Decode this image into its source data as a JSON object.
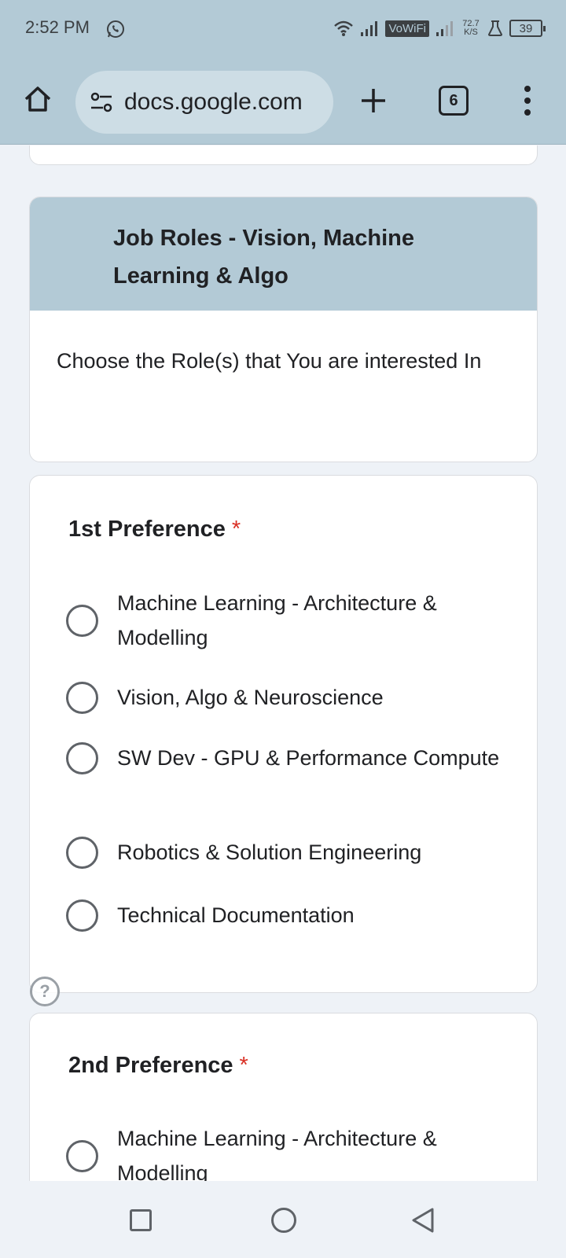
{
  "status_bar": {
    "time": "2:52 PM",
    "vowifi": "VoWiFi",
    "speed_value": "72.7",
    "speed_unit": "K/S",
    "battery": "39",
    "icons": [
      "whatsapp-icon",
      "wifi-icon",
      "signal-icon",
      "signal-icon",
      "lab-icon",
      "battery-icon"
    ]
  },
  "browser": {
    "url": "docs.google.com",
    "tab_count": "6",
    "icons": [
      "home-icon",
      "site-settings-icon",
      "plus-icon",
      "more-vert-icon"
    ]
  },
  "section": {
    "title": "Job Roles - Vision, Machine Learning & Algo",
    "description": "Choose the Role(s) that You are interested In"
  },
  "questions": [
    {
      "title": "1st Preference",
      "required_mark": "*",
      "options": [
        "Machine Learning - Architecture & Modelling",
        "Vision, Algo & Neuroscience",
        "SW Dev - GPU & Performance Compute",
        "Robotics & Solution Engineering",
        "Technical Documentation"
      ]
    },
    {
      "title": "2nd Preference",
      "required_mark": "*",
      "options": [
        "Machine Learning - Architecture & Modelling"
      ]
    }
  ],
  "help": "?",
  "colors": {
    "header_bg": "#b3cad6",
    "required": "#d93025",
    "page_bg": "#eef2f7"
  }
}
